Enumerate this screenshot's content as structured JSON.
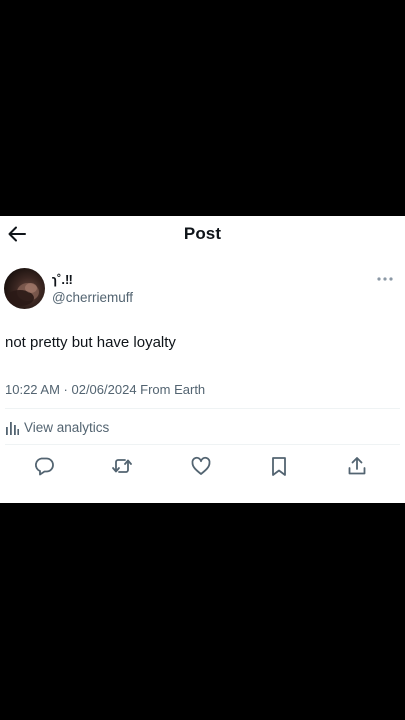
{
  "header": {
    "title": "Post",
    "back_icon": "arrow-left-icon"
  },
  "post": {
    "author": {
      "display_name": "ɿ˚.‼",
      "handle": "@cherriemuff"
    },
    "text": "not pretty but have loyalty",
    "meta": "10:22 AM · 02/06/2024 From Earth",
    "analytics_label": "View analytics",
    "more_icon": "more-horizontal-icon"
  },
  "actions": [
    {
      "icon": "reply-icon"
    },
    {
      "icon": "repost-icon"
    },
    {
      "icon": "like-icon"
    },
    {
      "icon": "bookmark-icon"
    },
    {
      "icon": "share-icon"
    }
  ],
  "colors": {
    "background": "#000000",
    "card": "#ffffff",
    "text_primary": "#0f1419",
    "text_secondary": "#536471",
    "divider": "#eff3f4"
  }
}
